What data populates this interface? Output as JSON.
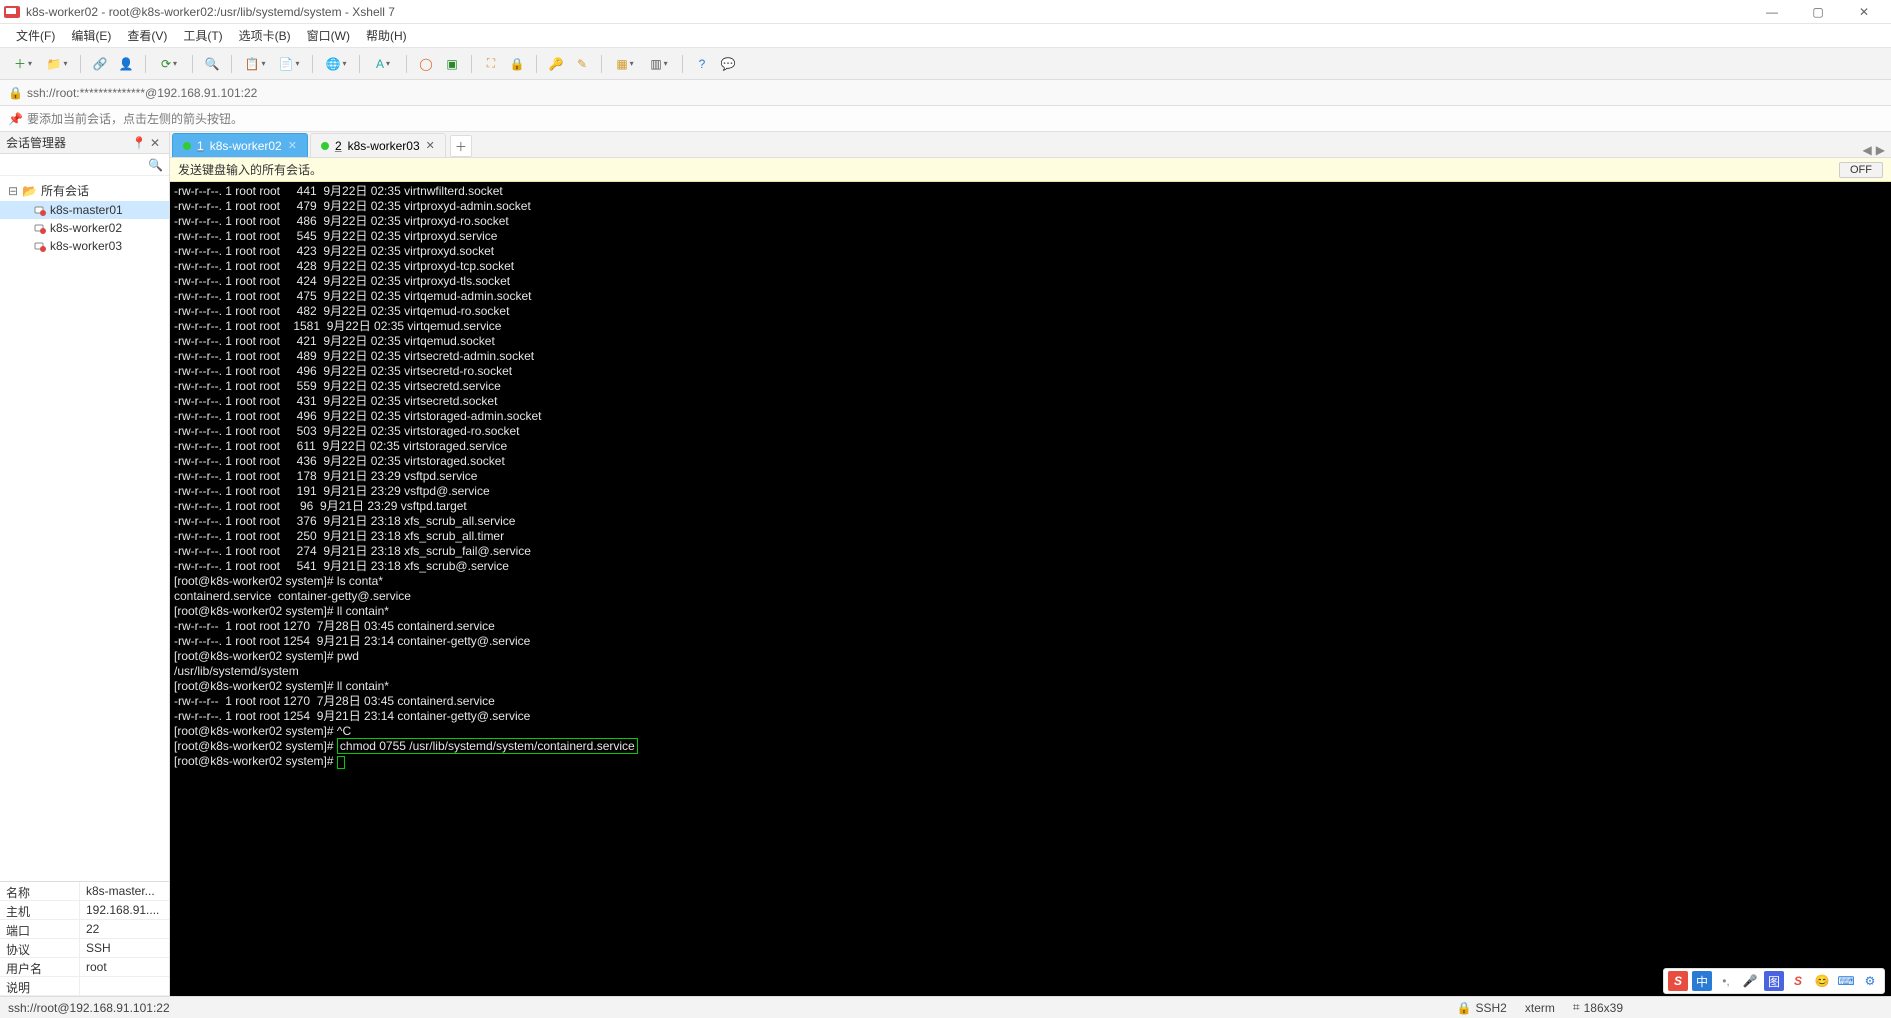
{
  "window": {
    "title": "k8s-worker02 - root@k8s-worker02:/usr/lib/systemd/system - Xshell 7"
  },
  "menubar": [
    "文件(F)",
    "编辑(E)",
    "查看(V)",
    "工具(T)",
    "选项卡(B)",
    "窗口(W)",
    "帮助(H)"
  ],
  "addressbar": {
    "url": "ssh://root:**************@192.168.91.101:22"
  },
  "tipbar": {
    "text": "要添加当前会话，点击左侧的箭头按钮。"
  },
  "sidebar": {
    "title": "会话管理器",
    "root_label": "所有会话",
    "items": [
      {
        "label": "k8s-master01",
        "selected": true
      },
      {
        "label": "k8s-worker02",
        "selected": false
      },
      {
        "label": "k8s-worker03",
        "selected": false
      }
    ],
    "props": [
      {
        "k": "名称",
        "v": "k8s-master..."
      },
      {
        "k": "主机",
        "v": "192.168.91...."
      },
      {
        "k": "端口",
        "v": "22"
      },
      {
        "k": "协议",
        "v": "SSH"
      },
      {
        "k": "用户名",
        "v": "root"
      },
      {
        "k": "说明",
        "v": ""
      }
    ]
  },
  "tabs": [
    {
      "num": "1",
      "label": "k8s-worker02",
      "active": true
    },
    {
      "num": "2",
      "label": "k8s-worker03",
      "active": false
    }
  ],
  "broadcast": {
    "text": "发送键盘输入的所有会话。",
    "off": "OFF"
  },
  "terminal": {
    "ls_lines": [
      "-rw-r--r--. 1 root root     441  9月22日 02:35 virtnwfilterd.socket",
      "-rw-r--r--. 1 root root     479  9月22日 02:35 virtproxyd-admin.socket",
      "-rw-r--r--. 1 root root     486  9月22日 02:35 virtproxyd-ro.socket",
      "-rw-r--r--. 1 root root     545  9月22日 02:35 virtproxyd.service",
      "-rw-r--r--. 1 root root     423  9月22日 02:35 virtproxyd.socket",
      "-rw-r--r--. 1 root root     428  9月22日 02:35 virtproxyd-tcp.socket",
      "-rw-r--r--. 1 root root     424  9月22日 02:35 virtproxyd-tls.socket",
      "-rw-r--r--. 1 root root     475  9月22日 02:35 virtqemud-admin.socket",
      "-rw-r--r--. 1 root root     482  9月22日 02:35 virtqemud-ro.socket",
      "-rw-r--r--. 1 root root    1581  9月22日 02:35 virtqemud.service",
      "-rw-r--r--. 1 root root     421  9月22日 02:35 virtqemud.socket",
      "-rw-r--r--. 1 root root     489  9月22日 02:35 virtsecretd-admin.socket",
      "-rw-r--r--. 1 root root     496  9月22日 02:35 virtsecretd-ro.socket",
      "-rw-r--r--. 1 root root     559  9月22日 02:35 virtsecretd.service",
      "-rw-r--r--. 1 root root     431  9月22日 02:35 virtsecretd.socket",
      "-rw-r--r--. 1 root root     496  9月22日 02:35 virtstoraged-admin.socket",
      "-rw-r--r--. 1 root root     503  9月22日 02:35 virtstoraged-ro.socket",
      "-rw-r--r--. 1 root root     611  9月22日 02:35 virtstoraged.service",
      "-rw-r--r--. 1 root root     436  9月22日 02:35 virtstoraged.socket",
      "-rw-r--r--. 1 root root     178  9月21日 23:29 vsftpd.service",
      "-rw-r--r--. 1 root root     191  9月21日 23:29 vsftpd@.service",
      "-rw-r--r--. 1 root root      96  9月21日 23:29 vsftpd.target",
      "-rw-r--r--. 1 root root     376  9月21日 23:18 xfs_scrub_all.service",
      "-rw-r--r--. 1 root root     250  9月21日 23:18 xfs_scrub_all.timer",
      "-rw-r--r--. 1 root root     274  9月21日 23:18 xfs_scrub_fail@.service",
      "-rw-r--r--. 1 root root     541  9月21日 23:18 xfs_scrub@.service"
    ],
    "cmd_lines": [
      "[root@k8s-worker02 system]# ls conta*",
      "containerd.service  container-getty@.service",
      "[root@k8s-worker02 system]# ll contain*",
      "-rw-r--r--  1 root root 1270  7月28日 03:45 containerd.service",
      "-rw-r--r--. 1 root root 1254  9月21日 23:14 container-getty@.service",
      "[root@k8s-worker02 system]# pwd",
      "/usr/lib/systemd/system",
      "[root@k8s-worker02 system]# ll contain*",
      "-rw-r--r--  1 root root 1270  7月28日 03:45 containerd.service",
      "-rw-r--r--. 1 root root 1254  9月21日 23:14 container-getty@.service",
      "[root@k8s-worker02 system]# ^C"
    ],
    "prompt": "[root@k8s-worker02 system]# ",
    "highlight_cmd": "chmod 0755 /usr/lib/systemd/system/containerd.service",
    "prompt2": "[root@k8s-worker02 system]# "
  },
  "statusbar": {
    "left": "ssh://root@192.168.91.101:22",
    "ssh": "SSH2",
    "term": "xterm",
    "size": "186x39"
  }
}
